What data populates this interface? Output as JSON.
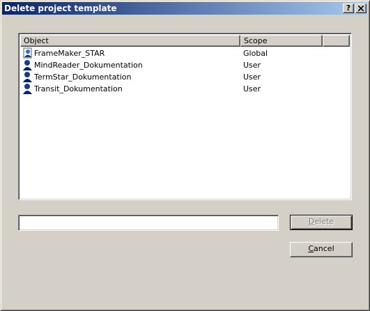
{
  "window": {
    "title": "Delete project template",
    "help_label": "?",
    "close_icon": "close-icon"
  },
  "list": {
    "columns": [
      "Object",
      "Scope",
      ""
    ],
    "rows": [
      {
        "name": "FrameMaker_STAR",
        "scope": "Global",
        "icon": "global-template-icon"
      },
      {
        "name": "MindReader_Dokumentation",
        "scope": "User",
        "icon": "user-template-icon"
      },
      {
        "name": "TermStar_Dokumentation",
        "scope": "User",
        "icon": "user-template-icon"
      },
      {
        "name": "Transit_Dokumentation",
        "scope": "User",
        "icon": "user-template-icon"
      }
    ]
  },
  "name_field": {
    "value": ""
  },
  "buttons": {
    "delete": {
      "pre": "",
      "accel": "D",
      "post": "elete",
      "enabled": false
    },
    "cancel": {
      "pre": "",
      "accel": "C",
      "post": "ancel",
      "enabled": true
    }
  },
  "colors": {
    "titlebar_start": "#0a246a",
    "titlebar_end": "#a6caf0",
    "face": "#d4d0c8"
  }
}
